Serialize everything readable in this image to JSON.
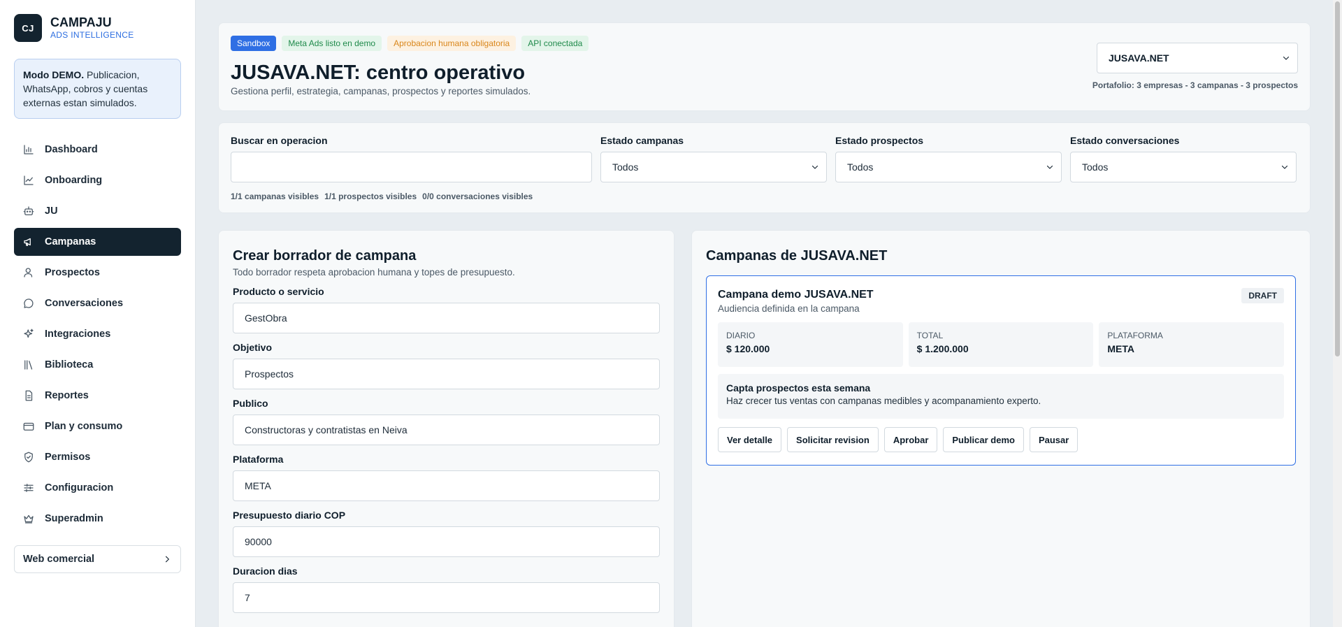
{
  "brand": {
    "logo": "CJ",
    "name": "CAMPAJU",
    "subtitle": "ADS INTELLIGENCE"
  },
  "demo_notice": {
    "bold": "Modo DEMO.",
    "text": " Publicacion, WhatsApp, cobros y cuentas externas estan simulados."
  },
  "sidebar": {
    "items": [
      {
        "label": "Dashboard",
        "icon": "bar-chart-icon"
      },
      {
        "label": "Onboarding",
        "icon": "line-chart-icon"
      },
      {
        "label": "JU",
        "icon": "robot-icon"
      },
      {
        "label": "Campanas",
        "icon": "megaphone-icon",
        "active": true
      },
      {
        "label": "Prospectos",
        "icon": "user-icon"
      },
      {
        "label": "Conversaciones",
        "icon": "chat-icon"
      },
      {
        "label": "Integraciones",
        "icon": "sparkles-icon"
      },
      {
        "label": "Biblioteca",
        "icon": "library-icon"
      },
      {
        "label": "Reportes",
        "icon": "document-icon"
      },
      {
        "label": "Plan y consumo",
        "icon": "credit-card-icon"
      },
      {
        "label": "Permisos",
        "icon": "shield-icon"
      },
      {
        "label": "Configuracion",
        "icon": "sliders-icon"
      },
      {
        "label": "Superadmin",
        "icon": "crown-icon"
      }
    ],
    "web_button": "Web comercial"
  },
  "header": {
    "badges": [
      "Sandbox",
      "Meta Ads listo en demo",
      "Aprobacion humana obligatoria",
      "API conectada"
    ],
    "title": "JUSAVA.NET: centro operativo",
    "subtitle": "Gestiona perfil, estrategia, campanas, prospectos y reportes simulados.",
    "company_select": "JUSAVA.NET",
    "portfolio": "Portafolio: 3 empresas - 3 campanas - 3 prospectos"
  },
  "filters": {
    "search_label": "Buscar en operacion",
    "search_value": "",
    "campaign_state_label": "Estado campanas",
    "campaign_state_value": "Todos",
    "prospect_state_label": "Estado prospectos",
    "prospect_state_value": "Todos",
    "conversation_state_label": "Estado conversaciones",
    "conversation_state_value": "Todos",
    "counts": [
      "1/1 campanas visibles",
      "1/1 prospectos visibles",
      "0/0 conversaciones visibles"
    ]
  },
  "form": {
    "title": "Crear borrador de campana",
    "subtitle": "Todo borrador respeta aprobacion humana y topes de presupuesto.",
    "fields": [
      {
        "label": "Producto o servicio",
        "value": "GestObra"
      },
      {
        "label": "Objetivo",
        "value": "Prospectos"
      },
      {
        "label": "Publico",
        "value": "Constructoras y contratistas en Neiva"
      },
      {
        "label": "Plataforma",
        "value": "META"
      },
      {
        "label": "Presupuesto diario COP",
        "value": "90000"
      },
      {
        "label": "Duracion dias",
        "value": "7"
      }
    ]
  },
  "campaigns": {
    "title": "Campanas de JUSAVA.NET",
    "card": {
      "name": "Campana demo JUSAVA.NET",
      "audience": "Audiencia definida en la campana",
      "status": "DRAFT",
      "metrics": [
        {
          "label": "DIARIO",
          "value": "$ 120.000"
        },
        {
          "label": "TOTAL",
          "value": "$ 1.200.000"
        },
        {
          "label": "PLATAFORMA",
          "value": "META"
        }
      ],
      "copy_title": "Capta prospectos esta semana",
      "copy_text": "Haz crecer tus ventas con campanas medibles y acompanamiento experto.",
      "actions": [
        "Ver detalle",
        "Solicitar revision",
        "Aprobar",
        "Publicar demo",
        "Pausar"
      ]
    }
  },
  "colors": {
    "accent": "#2f6fe4",
    "dark": "#13232f",
    "success": "#1f8a4b",
    "warning": "#d9861b"
  }
}
